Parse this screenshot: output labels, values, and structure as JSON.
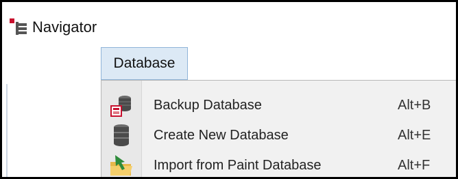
{
  "navigator": {
    "title": "Navigator",
    "icon": "navigator-tree-icon"
  },
  "menubar": {
    "database_label": "Database"
  },
  "dropdown": {
    "items": [
      {
        "label": "Backup Database",
        "shortcut": "Alt+B",
        "icon": "backup-database-icon"
      },
      {
        "label": "Create New Database",
        "shortcut": "Alt+E",
        "icon": "database-icon"
      },
      {
        "label": "Import from Paint Database",
        "shortcut": "Alt+F",
        "icon": "import-folder-icon"
      }
    ]
  },
  "colors": {
    "menubar_active_bg": "#dce9f5",
    "menubar_active_border": "#8fb4d8",
    "dropdown_bg": "#f1f1f1",
    "gutter_bg": "#e8e8e8"
  }
}
